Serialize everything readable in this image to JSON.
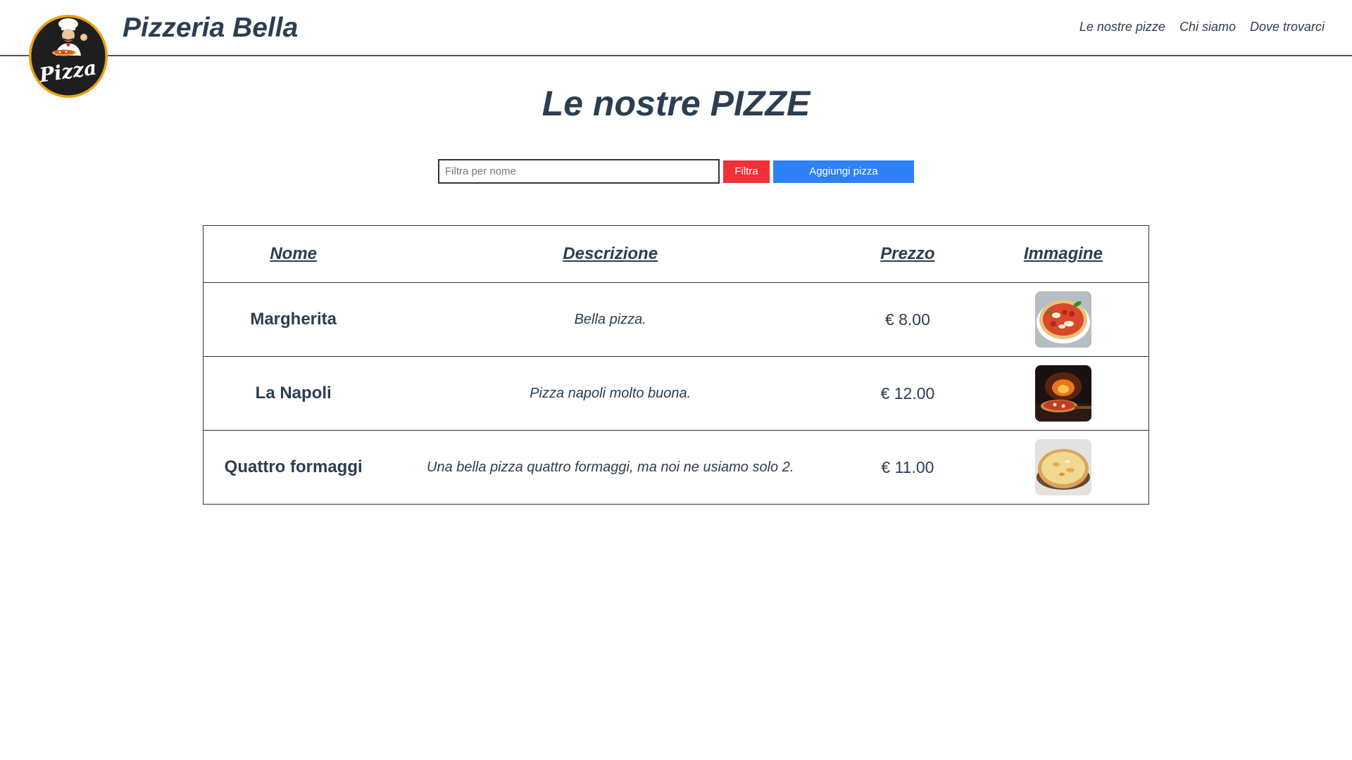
{
  "header": {
    "brand": "Pizzeria Bella",
    "logo_text": "Pizza",
    "nav": [
      {
        "label": "Le nostre pizze"
      },
      {
        "label": "Chi siamo"
      },
      {
        "label": "Dove trovarci"
      }
    ]
  },
  "page": {
    "title": "Le nostre PIZZE"
  },
  "toolbar": {
    "filter_placeholder": "Filtra per nome",
    "filter_value": "",
    "filter_label": "Filtra",
    "add_label": "Aggiungi pizza"
  },
  "table": {
    "headers": {
      "name": "Nome",
      "description": "Descrizione",
      "price": "Prezzo",
      "image": "Immagine"
    },
    "rows": [
      {
        "name": "Margherita",
        "description": "Bella pizza.",
        "price": "€ 8.00",
        "image": "margherita-photo"
      },
      {
        "name": "La Napoli",
        "description": "Pizza napoli molto buona.",
        "price": "€ 12.00",
        "image": "napoli-oven-photo"
      },
      {
        "name": "Quattro formaggi",
        "description": "Una bella pizza quattro formaggi, ma noi ne usiamo solo 2.",
        "price": "€ 11.00",
        "image": "quattro-formaggi-photo"
      }
    ]
  },
  "colors": {
    "text": "#2c3e50",
    "filter_button": "#f0303a",
    "add_button": "#2d81f7",
    "logo_ring": "#e8a317"
  }
}
